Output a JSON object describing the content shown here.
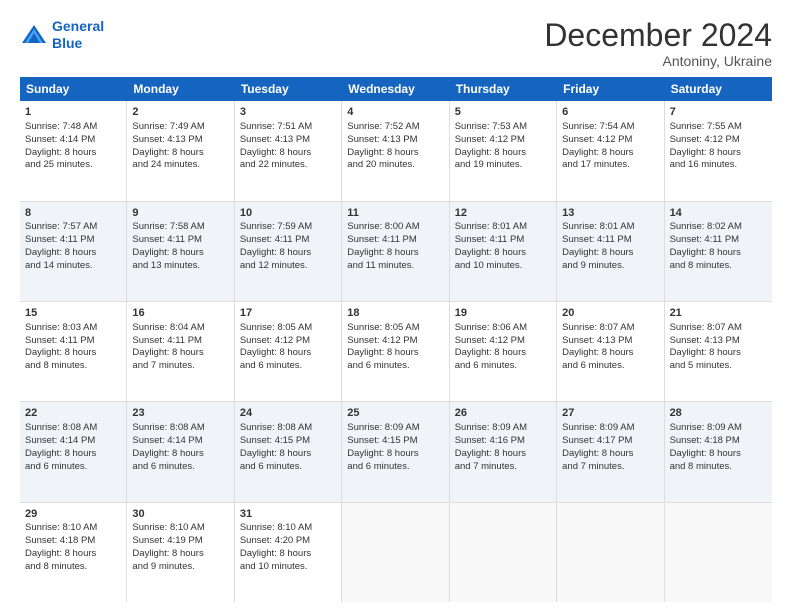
{
  "logo": {
    "line1": "General",
    "line2": "Blue"
  },
  "title": "December 2024",
  "subtitle": "Antoniny, Ukraine",
  "header_days": [
    "Sunday",
    "Monday",
    "Tuesday",
    "Wednesday",
    "Thursday",
    "Friday",
    "Saturday"
  ],
  "rows": [
    {
      "alt": false,
      "cells": [
        {
          "day": "1",
          "lines": [
            "Sunrise: 7:48 AM",
            "Sunset: 4:14 PM",
            "Daylight: 8 hours",
            "and 25 minutes."
          ]
        },
        {
          "day": "2",
          "lines": [
            "Sunrise: 7:49 AM",
            "Sunset: 4:13 PM",
            "Daylight: 8 hours",
            "and 24 minutes."
          ]
        },
        {
          "day": "3",
          "lines": [
            "Sunrise: 7:51 AM",
            "Sunset: 4:13 PM",
            "Daylight: 8 hours",
            "and 22 minutes."
          ]
        },
        {
          "day": "4",
          "lines": [
            "Sunrise: 7:52 AM",
            "Sunset: 4:13 PM",
            "Daylight: 8 hours",
            "and 20 minutes."
          ]
        },
        {
          "day": "5",
          "lines": [
            "Sunrise: 7:53 AM",
            "Sunset: 4:12 PM",
            "Daylight: 8 hours",
            "and 19 minutes."
          ]
        },
        {
          "day": "6",
          "lines": [
            "Sunrise: 7:54 AM",
            "Sunset: 4:12 PM",
            "Daylight: 8 hours",
            "and 17 minutes."
          ]
        },
        {
          "day": "7",
          "lines": [
            "Sunrise: 7:55 AM",
            "Sunset: 4:12 PM",
            "Daylight: 8 hours",
            "and 16 minutes."
          ]
        }
      ]
    },
    {
      "alt": true,
      "cells": [
        {
          "day": "8",
          "lines": [
            "Sunrise: 7:57 AM",
            "Sunset: 4:11 PM",
            "Daylight: 8 hours",
            "and 14 minutes."
          ]
        },
        {
          "day": "9",
          "lines": [
            "Sunrise: 7:58 AM",
            "Sunset: 4:11 PM",
            "Daylight: 8 hours",
            "and 13 minutes."
          ]
        },
        {
          "day": "10",
          "lines": [
            "Sunrise: 7:59 AM",
            "Sunset: 4:11 PM",
            "Daylight: 8 hours",
            "and 12 minutes."
          ]
        },
        {
          "day": "11",
          "lines": [
            "Sunrise: 8:00 AM",
            "Sunset: 4:11 PM",
            "Daylight: 8 hours",
            "and 11 minutes."
          ]
        },
        {
          "day": "12",
          "lines": [
            "Sunrise: 8:01 AM",
            "Sunset: 4:11 PM",
            "Daylight: 8 hours",
            "and 10 minutes."
          ]
        },
        {
          "day": "13",
          "lines": [
            "Sunrise: 8:01 AM",
            "Sunset: 4:11 PM",
            "Daylight: 8 hours",
            "and 9 minutes."
          ]
        },
        {
          "day": "14",
          "lines": [
            "Sunrise: 8:02 AM",
            "Sunset: 4:11 PM",
            "Daylight: 8 hours",
            "and 8 minutes."
          ]
        }
      ]
    },
    {
      "alt": false,
      "cells": [
        {
          "day": "15",
          "lines": [
            "Sunrise: 8:03 AM",
            "Sunset: 4:11 PM",
            "Daylight: 8 hours",
            "and 8 minutes."
          ]
        },
        {
          "day": "16",
          "lines": [
            "Sunrise: 8:04 AM",
            "Sunset: 4:11 PM",
            "Daylight: 8 hours",
            "and 7 minutes."
          ]
        },
        {
          "day": "17",
          "lines": [
            "Sunrise: 8:05 AM",
            "Sunset: 4:12 PM",
            "Daylight: 8 hours",
            "and 6 minutes."
          ]
        },
        {
          "day": "18",
          "lines": [
            "Sunrise: 8:05 AM",
            "Sunset: 4:12 PM",
            "Daylight: 8 hours",
            "and 6 minutes."
          ]
        },
        {
          "day": "19",
          "lines": [
            "Sunrise: 8:06 AM",
            "Sunset: 4:12 PM",
            "Daylight: 8 hours",
            "and 6 minutes."
          ]
        },
        {
          "day": "20",
          "lines": [
            "Sunrise: 8:07 AM",
            "Sunset: 4:13 PM",
            "Daylight: 8 hours",
            "and 6 minutes."
          ]
        },
        {
          "day": "21",
          "lines": [
            "Sunrise: 8:07 AM",
            "Sunset: 4:13 PM",
            "Daylight: 8 hours",
            "and 5 minutes."
          ]
        }
      ]
    },
    {
      "alt": true,
      "cells": [
        {
          "day": "22",
          "lines": [
            "Sunrise: 8:08 AM",
            "Sunset: 4:14 PM",
            "Daylight: 8 hours",
            "and 6 minutes."
          ]
        },
        {
          "day": "23",
          "lines": [
            "Sunrise: 8:08 AM",
            "Sunset: 4:14 PM",
            "Daylight: 8 hours",
            "and 6 minutes."
          ]
        },
        {
          "day": "24",
          "lines": [
            "Sunrise: 8:08 AM",
            "Sunset: 4:15 PM",
            "Daylight: 8 hours",
            "and 6 minutes."
          ]
        },
        {
          "day": "25",
          "lines": [
            "Sunrise: 8:09 AM",
            "Sunset: 4:15 PM",
            "Daylight: 8 hours",
            "and 6 minutes."
          ]
        },
        {
          "day": "26",
          "lines": [
            "Sunrise: 8:09 AM",
            "Sunset: 4:16 PM",
            "Daylight: 8 hours",
            "and 7 minutes."
          ]
        },
        {
          "day": "27",
          "lines": [
            "Sunrise: 8:09 AM",
            "Sunset: 4:17 PM",
            "Daylight: 8 hours",
            "and 7 minutes."
          ]
        },
        {
          "day": "28",
          "lines": [
            "Sunrise: 8:09 AM",
            "Sunset: 4:18 PM",
            "Daylight: 8 hours",
            "and 8 minutes."
          ]
        }
      ]
    },
    {
      "alt": false,
      "cells": [
        {
          "day": "29",
          "lines": [
            "Sunrise: 8:10 AM",
            "Sunset: 4:18 PM",
            "Daylight: 8 hours",
            "and 8 minutes."
          ]
        },
        {
          "day": "30",
          "lines": [
            "Sunrise: 8:10 AM",
            "Sunset: 4:19 PM",
            "Daylight: 8 hours",
            "and 9 minutes."
          ]
        },
        {
          "day": "31",
          "lines": [
            "Sunrise: 8:10 AM",
            "Sunset: 4:20 PM",
            "Daylight: 8 hours",
            "and 10 minutes."
          ]
        },
        {
          "day": "",
          "lines": []
        },
        {
          "day": "",
          "lines": []
        },
        {
          "day": "",
          "lines": []
        },
        {
          "day": "",
          "lines": []
        }
      ]
    }
  ]
}
